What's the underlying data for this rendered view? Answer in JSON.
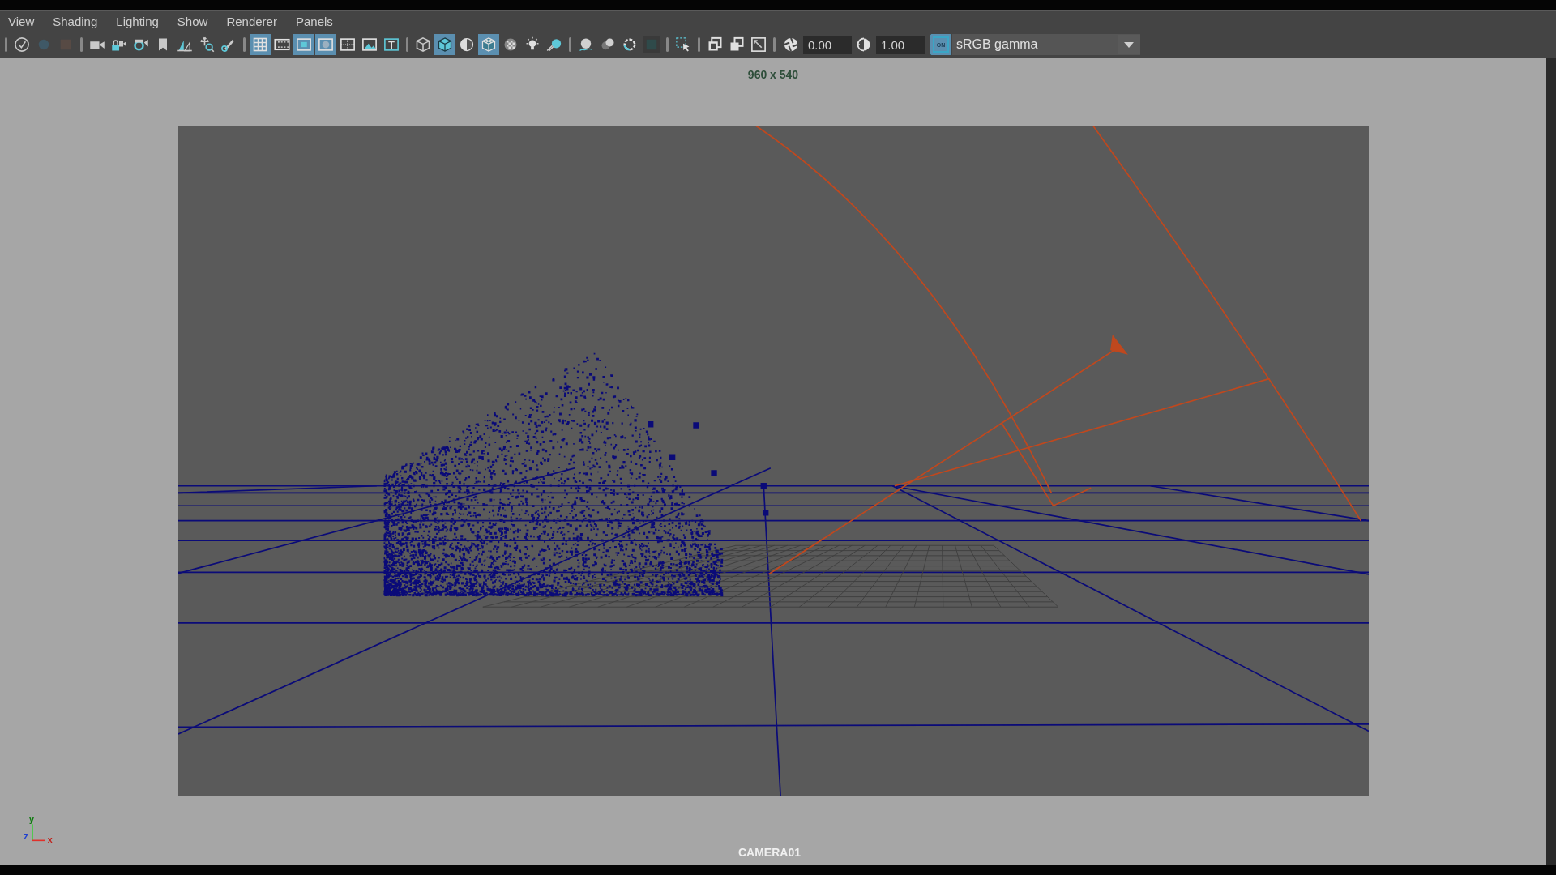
{
  "menu": [
    {
      "label": "View"
    },
    {
      "label": "Shading"
    },
    {
      "label": "Lighting"
    },
    {
      "label": "Show"
    },
    {
      "label": "Renderer"
    },
    {
      "label": "Panels"
    }
  ],
  "toolbar": {
    "groups": [
      [
        {
          "selected": false
        },
        {
          "selected": false
        },
        {
          "selected": false
        }
      ],
      [
        {
          "selected": false
        },
        {
          "selected": false
        },
        {
          "selected": false
        },
        {
          "selected": false
        },
        {
          "selected": false
        },
        {
          "selected": false
        },
        {
          "selected": false
        }
      ],
      [
        {
          "selected": true
        },
        {
          "selected": false
        },
        {
          "selected": true
        },
        {
          "selected": true
        },
        {
          "selected": false
        },
        {
          "selected": false
        },
        {
          "selected": false
        }
      ],
      [
        {
          "selected": false
        },
        {
          "selected": true
        },
        {
          "selected": false
        },
        {
          "selected": true
        },
        {
          "selected": false
        },
        {
          "selected": false
        },
        {
          "selected": false
        }
      ],
      [
        {
          "selected": false
        },
        {
          "selected": false
        },
        {
          "selected": false
        },
        {
          "selected": false
        }
      ],
      [
        {
          "selected": false
        }
      ],
      [
        {
          "selected": false
        },
        {
          "selected": false
        },
        {
          "selected": false
        }
      ]
    ]
  },
  "exposure": {
    "value": "0.00"
  },
  "gamma": {
    "value": "1.00"
  },
  "color_management": {
    "label": "ON",
    "on": true
  },
  "view_transform": {
    "value": "sRGB gamma"
  },
  "viewport": {
    "resolution": "960 x 540",
    "camera": "CAMERA01",
    "axes": [
      {
        "label": "y",
        "kind": "y"
      },
      {
        "label": "z",
        "kind": "z"
      },
      {
        "label": "x",
        "kind": "x"
      }
    ]
  }
}
